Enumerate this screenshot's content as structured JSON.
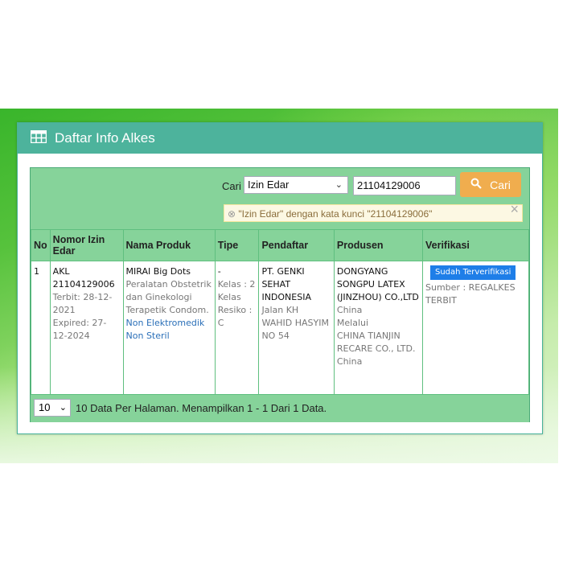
{
  "panel": {
    "title": "Daftar Info Alkes"
  },
  "search": {
    "label": "Cari",
    "field_selected": "Izin Edar",
    "keyword": "21104129006",
    "button": "Cari",
    "alert": "\"Izin Edar\" dengan kata kunci \"21104129006\""
  },
  "table": {
    "headers": {
      "no": "No",
      "nomor": "Nomor Izin Edar",
      "produk": "Nama Produk",
      "tipe": "Tipe",
      "pendaftar": "Pendaftar",
      "produsen": "Produsen",
      "verifikasi": "Verifikasi"
    },
    "rows": [
      {
        "no": "1",
        "nomor": "AKL 21104129006",
        "terbit": "Terbit: 28-12-2021",
        "expired": "Expired: 27-12-2024",
        "produk_nama": "MIRAI Big Dots",
        "produk_kategori": "Peralatan Obstetrik dan Ginekologi Terapetik Condom.",
        "produk_elektro": "Non Elektromedik",
        "produk_steril": "Non Steril",
        "tipe": "-",
        "kelas": "Kelas : 2",
        "resiko": "Kelas Resiko : C",
        "pendaftar_nama": "PT. GENKI SEHAT INDONESIA",
        "pendaftar_alamat": "Jalan KH WAHID HASYIM NO 54",
        "produsen_nama": "DONGYANG SONGPU LATEX (JINZHOU) CO.,LTD",
        "produsen_negara": "China",
        "melalui": "Melalui",
        "produsen_melalui": "CHINA TIANJIN RECARE CO., LTD.",
        "produsen_melalui_negara": "China",
        "verifikasi_badge": "Sudah Terverifikasi",
        "sumber": "Sumber : REGALKES TERBIT"
      }
    ]
  },
  "footer": {
    "per_page": "10",
    "text": "10 Data Per Halaman. Menampilkan 1 - 1 Dari 1 Data."
  },
  "colors": {
    "header": "#4db39c",
    "table_green": "#86d39a",
    "button": "#f0ad4e",
    "badge": "#1e7ee8"
  }
}
